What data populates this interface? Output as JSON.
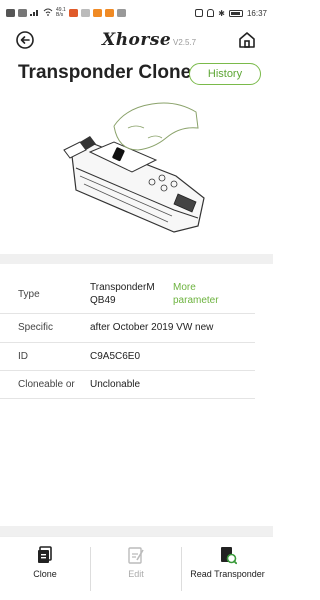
{
  "status_bar": {
    "clock": "16:37",
    "net_speed": "49.1",
    "net_unit": "B/s",
    "battery_icon": "battery-icon"
  },
  "nav": {
    "logo": "Xhorse",
    "version": "V2.5.7",
    "back_icon": "back-arrow-icon",
    "home_icon": "home-icon"
  },
  "page": {
    "title": "Transponder Clone",
    "history_label": "History"
  },
  "info": {
    "rows": [
      {
        "label": "Type",
        "value_line1": "TransponderM",
        "value_line2": "QB49"
      },
      {
        "label": "Specific",
        "value": "after October 2019 VW new"
      },
      {
        "label": "ID",
        "value": "C9A5C6E0"
      },
      {
        "label": "Cloneable or",
        "value": "Unclonable"
      }
    ],
    "more_line1": "More",
    "more_line2": "parameter"
  },
  "tabs": [
    {
      "label": "Clone",
      "icon": "clone-icon",
      "enabled": true
    },
    {
      "label": "Edit",
      "icon": "edit-icon",
      "enabled": false
    },
    {
      "label": "Read Transponder",
      "icon": "read-transponder-icon",
      "enabled": true
    }
  ],
  "colors": {
    "accent_green": "#6db33f",
    "separator_gray": "#f0f0f0"
  }
}
